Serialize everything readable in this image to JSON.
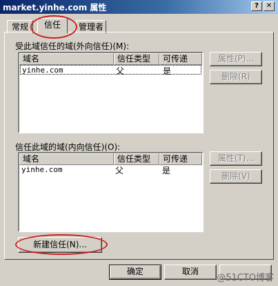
{
  "window": {
    "title": "market.yinhe.com 属性",
    "help_glyph": "?",
    "close_glyph": "✕"
  },
  "tabs": [
    {
      "label": "常规"
    },
    {
      "label": "信任"
    },
    {
      "label": "管理者"
    }
  ],
  "outgoing": {
    "label": "受此域信任的域(外向信任)(M):",
    "columns": [
      "域名",
      "信任类型",
      "可传递"
    ],
    "rows": [
      {
        "domain": "yinhe.com",
        "type": "父",
        "transitive": "是"
      }
    ],
    "properties_button": "属性(P)...",
    "remove_button": "删除(R)"
  },
  "incoming": {
    "label": "信任此域的域(内向信任)(O):",
    "columns": [
      "域名",
      "信任类型",
      "可传递"
    ],
    "rows": [
      {
        "domain": "yinhe.com",
        "type": "父",
        "transitive": "是"
      }
    ],
    "properties_button": "属性(T)...",
    "remove_button": "删除(V)"
  },
  "new_trust_button": "新建信任(N)...",
  "footer": {
    "ok": "确定",
    "cancel": "取消"
  },
  "watermark": "@51CTO博客",
  "colors": {
    "title_start": "#0a246a",
    "annotation": "#cc1f1f"
  }
}
